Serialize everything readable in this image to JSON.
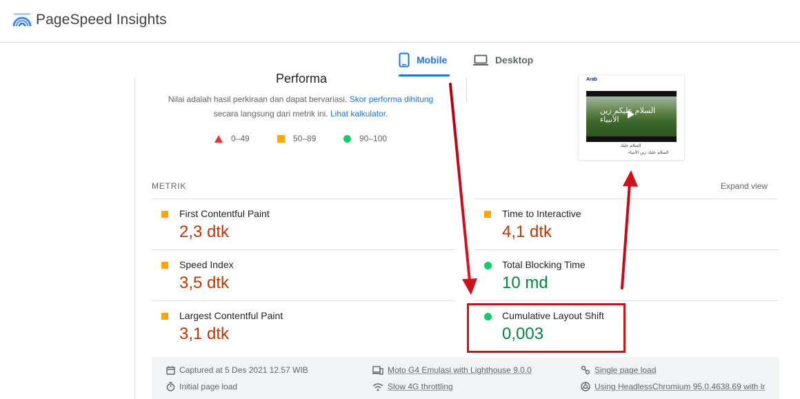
{
  "header": {
    "brand": "PageSpeed Insights",
    "logo_icon": "pagespeed-logo-icon"
  },
  "tabs": [
    {
      "label": "Mobile",
      "icon": "smartphone-icon",
      "selected": true
    },
    {
      "label": "Desktop",
      "icon": "laptop-icon",
      "selected": false
    }
  ],
  "performance": {
    "title": "Performa",
    "desc_prefix": "Nilai adalah hasil perkiraan dan dapat bervariasi. ",
    "desc_link1": "Skor performa dihitung",
    "desc_middle": "secara langsung dari metrik ini. ",
    "desc_link2": "Lihat kalkulator",
    "desc_suffix": ".",
    "legend": [
      {
        "range": "0–49",
        "shape": "triangle",
        "color": "#ee3333"
      },
      {
        "range": "50–89",
        "shape": "square",
        "color": "#ffa400"
      },
      {
        "range": "90–100",
        "shape": "circle",
        "color": "#0cce6b"
      }
    ]
  },
  "screenshot": {
    "label": "Arab",
    "overlay_text": "السلام عليكم زين الأنبياء",
    "caption1": "السلام عليك",
    "caption2": "السلام عليك زين الأنبياء"
  },
  "metrics_section": {
    "heading": "METRIK",
    "expand_label": "Expand view",
    "items": [
      {
        "name": "First Contentful Paint",
        "value": "2,3 dtk",
        "status": "average"
      },
      {
        "name": "Time to Interactive",
        "value": "4,1 dtk",
        "status": "average"
      },
      {
        "name": "Speed Index",
        "value": "3,5 dtk",
        "status": "average"
      },
      {
        "name": "Total Blocking Time",
        "value": "10 md",
        "status": "pass"
      },
      {
        "name": "Largest Contentful Paint",
        "value": "3,1 dtk",
        "status": "average"
      },
      {
        "name": "Cumulative Layout Shift",
        "value": "0,003",
        "status": "pass"
      }
    ]
  },
  "footer": {
    "captured": "Captured at 5 Des 2021 12.57 WIB",
    "initial_load": "Initial page load",
    "device": "Moto G4 Emulasi with Lighthouse 9.0.0",
    "throttling": "Slow 4G throttling",
    "session": "Single page load",
    "browser": "Using HeadlessChromium 95.0.4638.69 with lr"
  },
  "colors": {
    "accent": "#1a73e8",
    "fail": "#ee3333",
    "average": "#ffa400",
    "pass": "#0cce6b",
    "value_average": "#c33300",
    "value_pass": "#018642",
    "annotation": "#d0111b"
  }
}
